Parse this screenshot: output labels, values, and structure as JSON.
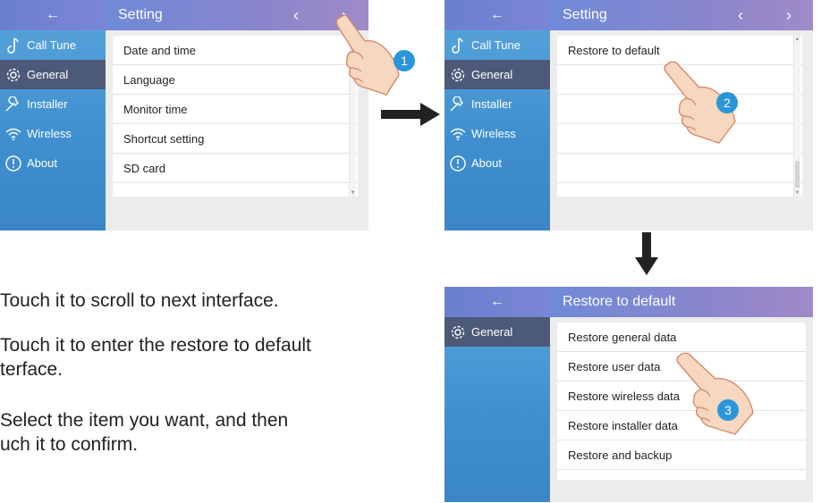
{
  "screen1": {
    "back": "←",
    "title": "Setting",
    "prev": "‹",
    "next": "›",
    "sidebar": [
      {
        "label": "Call Tune",
        "icon": "music-note-icon",
        "selected": false
      },
      {
        "label": "General",
        "icon": "gear-icon",
        "selected": true
      },
      {
        "label": "Installer",
        "icon": "wrench-icon",
        "selected": false
      },
      {
        "label": "Wireless",
        "icon": "wifi-icon",
        "selected": false
      },
      {
        "label": "About",
        "icon": "info-icon",
        "selected": false
      }
    ],
    "items": [
      "Date and time",
      "Language",
      "Monitor time",
      "Shortcut setting",
      "SD card"
    ],
    "badge": "1"
  },
  "screen2": {
    "back": "←",
    "title": "Setting",
    "prev": "‹",
    "next": "›",
    "sidebar": [
      {
        "label": "Call Tune"
      },
      {
        "label": "General"
      },
      {
        "label": "Installer"
      },
      {
        "label": "Wireless"
      },
      {
        "label": "About"
      }
    ],
    "items": [
      "Restore to default"
    ],
    "badge": "2"
  },
  "screen3": {
    "back": "←",
    "title": "Restore to default",
    "sidebar": [
      {
        "label": "General"
      }
    ],
    "items": [
      "Restore general data",
      "Restore user data",
      "Restore wireless data",
      "Restore installer data",
      "Restore and backup"
    ],
    "badge": "3"
  },
  "instructions": {
    "line1": " Touch it to scroll to next interface.",
    "line2a": " Touch it to enter the restore to default",
    "line2b": "terface.",
    "line3a": " Select the item you want, and then",
    "line3b": "uch it to confirm."
  }
}
